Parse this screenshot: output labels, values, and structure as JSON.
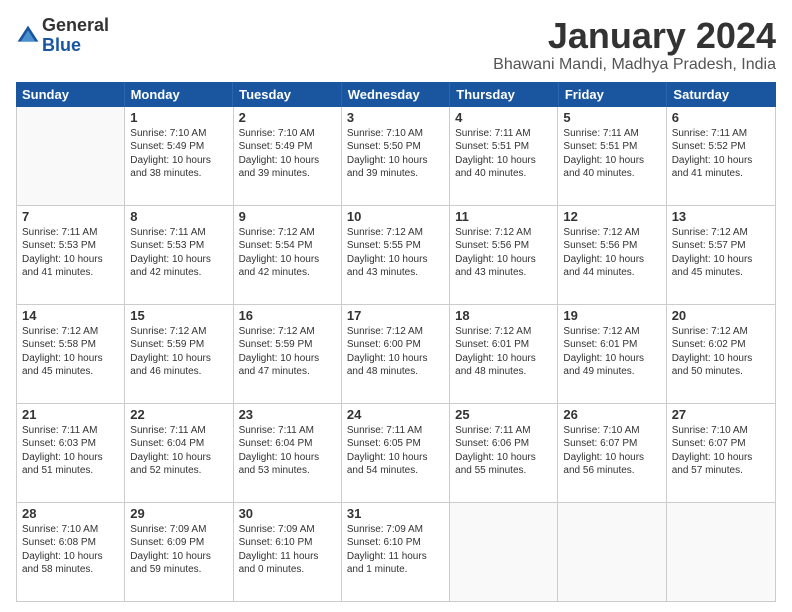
{
  "logo": {
    "general": "General",
    "blue": "Blue"
  },
  "title": "January 2024",
  "location": "Bhawani Mandi, Madhya Pradesh, India",
  "days": [
    "Sunday",
    "Monday",
    "Tuesday",
    "Wednesday",
    "Thursday",
    "Friday",
    "Saturday"
  ],
  "weeks": [
    [
      {
        "day": "",
        "info": ""
      },
      {
        "day": "1",
        "info": "Sunrise: 7:10 AM\nSunset: 5:49 PM\nDaylight: 10 hours\nand 38 minutes."
      },
      {
        "day": "2",
        "info": "Sunrise: 7:10 AM\nSunset: 5:49 PM\nDaylight: 10 hours\nand 39 minutes."
      },
      {
        "day": "3",
        "info": "Sunrise: 7:10 AM\nSunset: 5:50 PM\nDaylight: 10 hours\nand 39 minutes."
      },
      {
        "day": "4",
        "info": "Sunrise: 7:11 AM\nSunset: 5:51 PM\nDaylight: 10 hours\nand 40 minutes."
      },
      {
        "day": "5",
        "info": "Sunrise: 7:11 AM\nSunset: 5:51 PM\nDaylight: 10 hours\nand 40 minutes."
      },
      {
        "day": "6",
        "info": "Sunrise: 7:11 AM\nSunset: 5:52 PM\nDaylight: 10 hours\nand 41 minutes."
      }
    ],
    [
      {
        "day": "7",
        "info": "Sunrise: 7:11 AM\nSunset: 5:53 PM\nDaylight: 10 hours\nand 41 minutes."
      },
      {
        "day": "8",
        "info": "Sunrise: 7:11 AM\nSunset: 5:53 PM\nDaylight: 10 hours\nand 42 minutes."
      },
      {
        "day": "9",
        "info": "Sunrise: 7:12 AM\nSunset: 5:54 PM\nDaylight: 10 hours\nand 42 minutes."
      },
      {
        "day": "10",
        "info": "Sunrise: 7:12 AM\nSunset: 5:55 PM\nDaylight: 10 hours\nand 43 minutes."
      },
      {
        "day": "11",
        "info": "Sunrise: 7:12 AM\nSunset: 5:56 PM\nDaylight: 10 hours\nand 43 minutes."
      },
      {
        "day": "12",
        "info": "Sunrise: 7:12 AM\nSunset: 5:56 PM\nDaylight: 10 hours\nand 44 minutes."
      },
      {
        "day": "13",
        "info": "Sunrise: 7:12 AM\nSunset: 5:57 PM\nDaylight: 10 hours\nand 45 minutes."
      }
    ],
    [
      {
        "day": "14",
        "info": "Sunrise: 7:12 AM\nSunset: 5:58 PM\nDaylight: 10 hours\nand 45 minutes."
      },
      {
        "day": "15",
        "info": "Sunrise: 7:12 AM\nSunset: 5:59 PM\nDaylight: 10 hours\nand 46 minutes."
      },
      {
        "day": "16",
        "info": "Sunrise: 7:12 AM\nSunset: 5:59 PM\nDaylight: 10 hours\nand 47 minutes."
      },
      {
        "day": "17",
        "info": "Sunrise: 7:12 AM\nSunset: 6:00 PM\nDaylight: 10 hours\nand 48 minutes."
      },
      {
        "day": "18",
        "info": "Sunrise: 7:12 AM\nSunset: 6:01 PM\nDaylight: 10 hours\nand 48 minutes."
      },
      {
        "day": "19",
        "info": "Sunrise: 7:12 AM\nSunset: 6:01 PM\nDaylight: 10 hours\nand 49 minutes."
      },
      {
        "day": "20",
        "info": "Sunrise: 7:12 AM\nSunset: 6:02 PM\nDaylight: 10 hours\nand 50 minutes."
      }
    ],
    [
      {
        "day": "21",
        "info": "Sunrise: 7:11 AM\nSunset: 6:03 PM\nDaylight: 10 hours\nand 51 minutes."
      },
      {
        "day": "22",
        "info": "Sunrise: 7:11 AM\nSunset: 6:04 PM\nDaylight: 10 hours\nand 52 minutes."
      },
      {
        "day": "23",
        "info": "Sunrise: 7:11 AM\nSunset: 6:04 PM\nDaylight: 10 hours\nand 53 minutes."
      },
      {
        "day": "24",
        "info": "Sunrise: 7:11 AM\nSunset: 6:05 PM\nDaylight: 10 hours\nand 54 minutes."
      },
      {
        "day": "25",
        "info": "Sunrise: 7:11 AM\nSunset: 6:06 PM\nDaylight: 10 hours\nand 55 minutes."
      },
      {
        "day": "26",
        "info": "Sunrise: 7:10 AM\nSunset: 6:07 PM\nDaylight: 10 hours\nand 56 minutes."
      },
      {
        "day": "27",
        "info": "Sunrise: 7:10 AM\nSunset: 6:07 PM\nDaylight: 10 hours\nand 57 minutes."
      }
    ],
    [
      {
        "day": "28",
        "info": "Sunrise: 7:10 AM\nSunset: 6:08 PM\nDaylight: 10 hours\nand 58 minutes."
      },
      {
        "day": "29",
        "info": "Sunrise: 7:09 AM\nSunset: 6:09 PM\nDaylight: 10 hours\nand 59 minutes."
      },
      {
        "day": "30",
        "info": "Sunrise: 7:09 AM\nSunset: 6:10 PM\nDaylight: 11 hours\nand 0 minutes."
      },
      {
        "day": "31",
        "info": "Sunrise: 7:09 AM\nSunset: 6:10 PM\nDaylight: 11 hours\nand 1 minute."
      },
      {
        "day": "",
        "info": ""
      },
      {
        "day": "",
        "info": ""
      },
      {
        "day": "",
        "info": ""
      }
    ]
  ]
}
